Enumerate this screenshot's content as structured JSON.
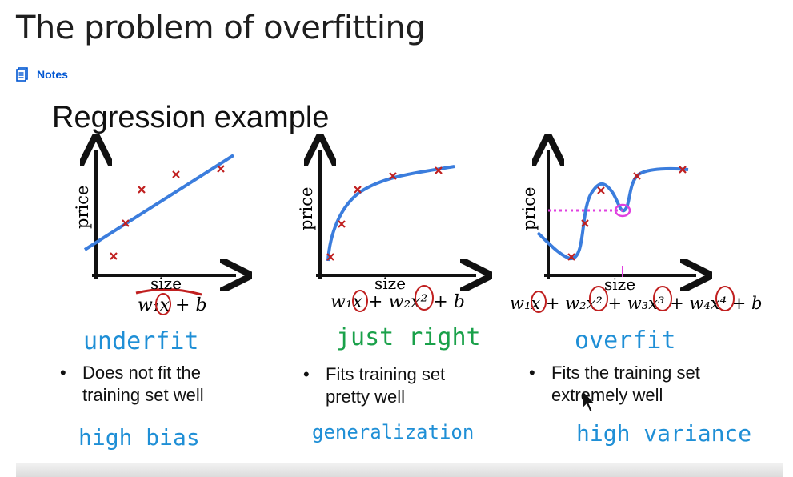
{
  "page": {
    "title": "The problem of overfitting",
    "notes_label": "Notes"
  },
  "slide": {
    "title": "Regression example",
    "panels": [
      {
        "axis_y": "price",
        "axis_x": "size",
        "equation": "w₁x + b",
        "handwritten_label": "underfit",
        "bullet": [
          "Does not fit the",
          "training set well"
        ],
        "handwritten_note": "high bias",
        "label_color": "#1f8fd6"
      },
      {
        "axis_y": "price",
        "axis_x": "size",
        "equation": "w₁x + w₂x² + b",
        "handwritten_label": "just right",
        "bullet": [
          "Fits training set",
          "pretty well"
        ],
        "handwritten_note": "generalization",
        "label_color": "#1aa14a",
        "note_color": "#1f8fd6"
      },
      {
        "axis_y": "price",
        "axis_x": "size",
        "equation": "w₁x + w₂x² + w₃x³ + w₄x⁴ + b",
        "handwritten_label": "overfit",
        "bullet": [
          "Fits the training set",
          "extremely well"
        ],
        "handwritten_note": "high variance",
        "label_color": "#1f8fd6"
      }
    ]
  },
  "colors": {
    "curve": "#3b7ddd",
    "marker": "#c01f1f",
    "dotted": "#e040e0",
    "link": "#0056d2"
  },
  "icons": [
    "notes-icon",
    "cursor-icon"
  ]
}
